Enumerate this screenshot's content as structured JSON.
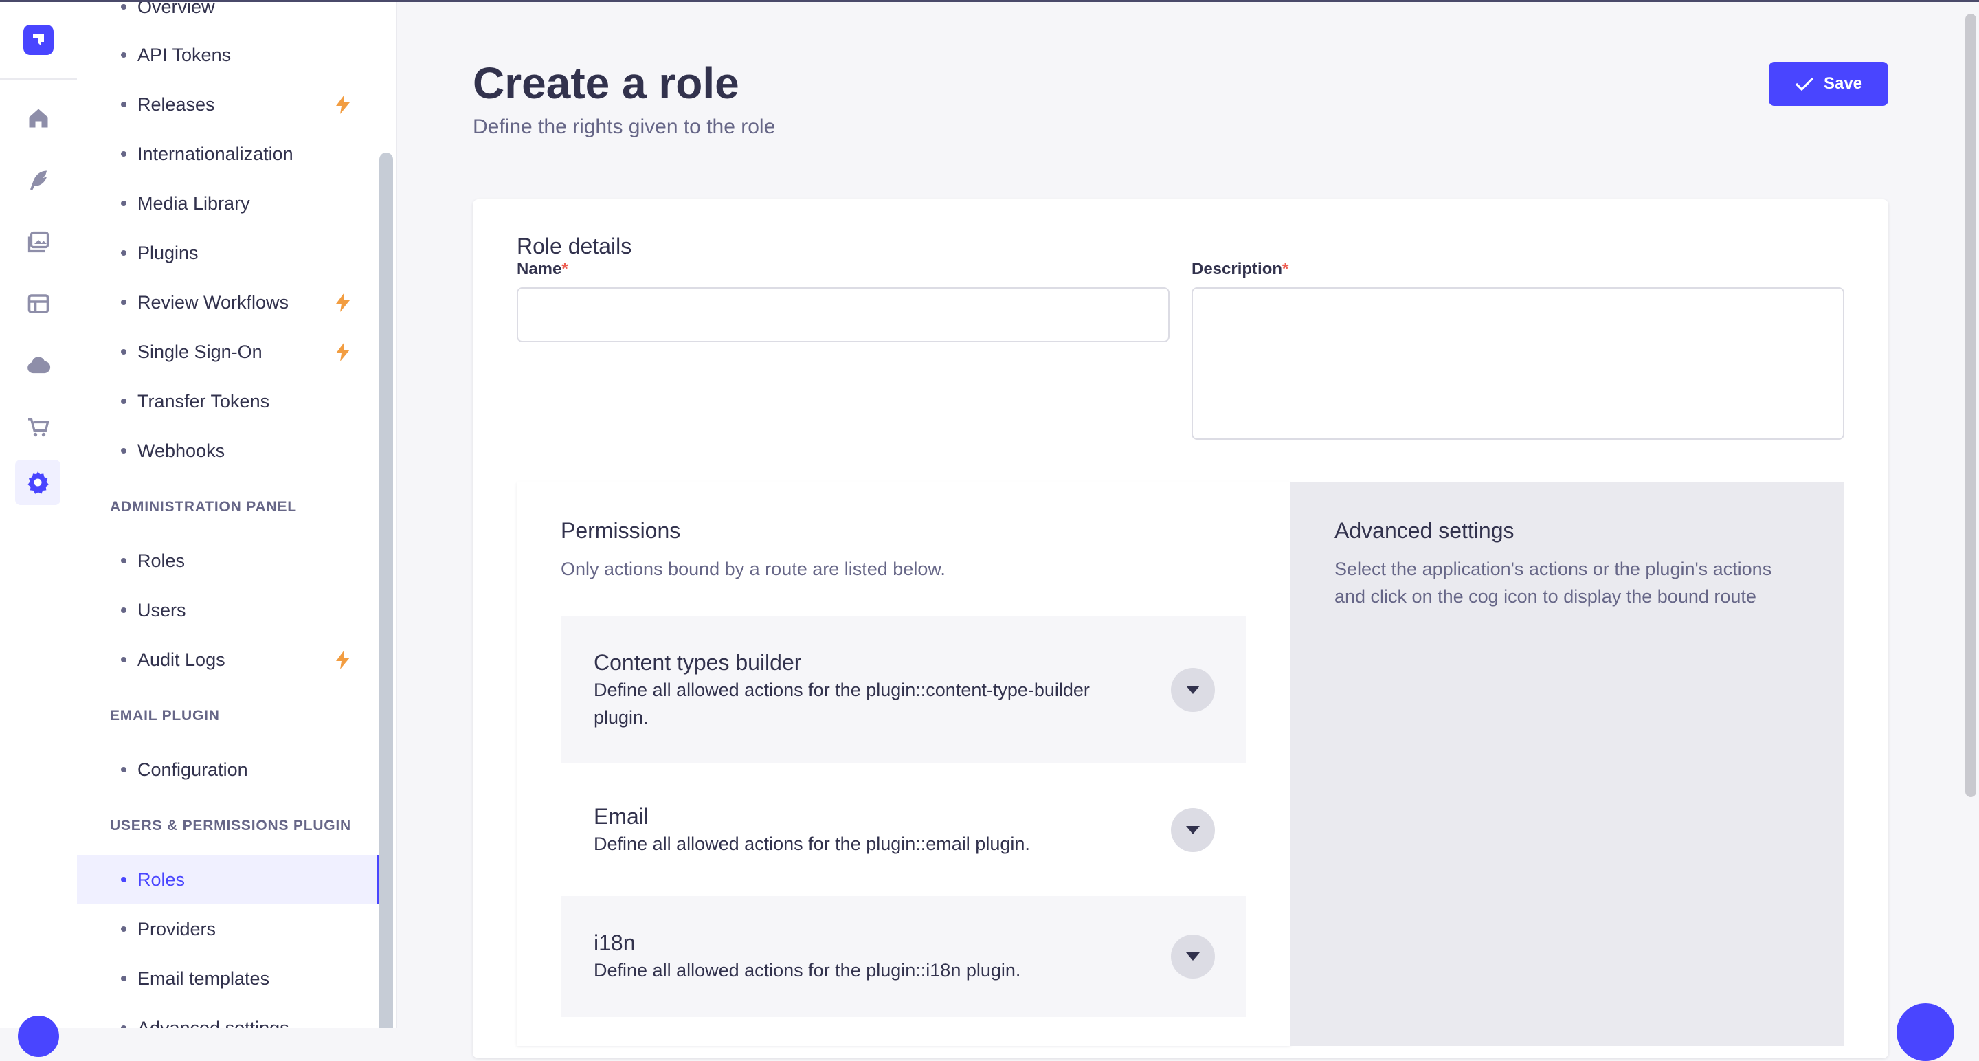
{
  "rail": {
    "items": [
      {
        "name": "home-icon"
      },
      {
        "name": "content-manager-icon"
      },
      {
        "name": "media-library-icon"
      },
      {
        "name": "content-type-builder-icon"
      },
      {
        "name": "cloud-icon"
      },
      {
        "name": "marketplace-icon"
      },
      {
        "name": "settings-icon"
      }
    ]
  },
  "subnav": {
    "top_items": [
      {
        "label": "Overview",
        "bolt": false
      },
      {
        "label": "API Tokens",
        "bolt": false
      },
      {
        "label": "Releases",
        "bolt": true
      },
      {
        "label": "Internationalization",
        "bolt": false
      },
      {
        "label": "Media Library",
        "bolt": false
      },
      {
        "label": "Plugins",
        "bolt": false
      },
      {
        "label": "Review Workflows",
        "bolt": true
      },
      {
        "label": "Single Sign-On",
        "bolt": true
      },
      {
        "label": "Transfer Tokens",
        "bolt": false
      },
      {
        "label": "Webhooks",
        "bolt": false
      }
    ],
    "admin_title": "ADMINISTRATION PANEL",
    "admin_items": [
      {
        "label": "Roles",
        "bolt": false
      },
      {
        "label": "Users",
        "bolt": false
      },
      {
        "label": "Audit Logs",
        "bolt": true
      }
    ],
    "email_title": "EMAIL PLUGIN",
    "email_items": [
      {
        "label": "Configuration",
        "bolt": false
      }
    ],
    "up_title": "USERS & PERMISSIONS PLUGIN",
    "up_items": [
      {
        "label": "Roles",
        "active": true
      },
      {
        "label": "Providers",
        "active": false
      },
      {
        "label": "Email templates",
        "active": false
      },
      {
        "label": "Advanced settings",
        "active": false
      }
    ]
  },
  "header": {
    "title": "Create a role",
    "subtitle": "Define the rights given to the role",
    "save_label": "Save"
  },
  "role_details": {
    "title": "Role details",
    "name_label": "Name",
    "description_label": "Description",
    "required_mark": "*",
    "name_value": "",
    "description_value": ""
  },
  "permissions": {
    "title": "Permissions",
    "subtitle": "Only actions bound by a route are listed below.",
    "sections": [
      {
        "title": "Content types builder",
        "description": "Define all allowed actions for the plugin::content-type-builder plugin."
      },
      {
        "title": "Email",
        "description": "Define all allowed actions for the plugin::email plugin."
      },
      {
        "title": "i18n",
        "description": "Define all allowed actions for the plugin::i18n plugin."
      }
    ]
  },
  "advanced": {
    "title": "Advanced settings",
    "text": "Select the application's actions or the plugin's actions and click on the cog icon to display the bound route"
  },
  "colors": {
    "primary": "#4945ff",
    "bolt": "#f29d41",
    "required": "#ee5e52"
  }
}
